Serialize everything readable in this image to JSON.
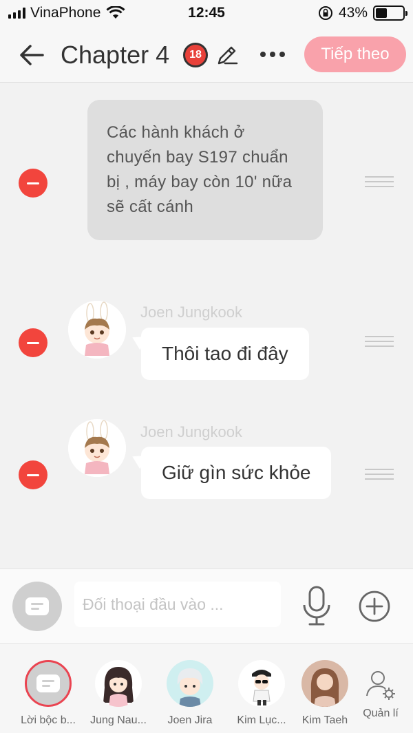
{
  "status_bar": {
    "carrier": "VinaPhone",
    "time": "12:45",
    "battery_percent": "43%",
    "battery_level": 0.43
  },
  "header": {
    "title": "Chapter 4",
    "rating_badge": "18",
    "next_button": "Tiếp theo"
  },
  "messages": [
    {
      "type": "narration",
      "text": "Các hành khách ở chuyến bay S197 chuẩn bị , máy bay còn 10' nữa sẽ cất cánh"
    },
    {
      "type": "dialog",
      "speaker": "Joen Jungkook",
      "text": "Thôi tao đi đây"
    },
    {
      "type": "dialog",
      "speaker": "Joen Jungkook",
      "text": "Giữ gìn sức khỏe"
    }
  ],
  "input": {
    "placeholder": "Đối thoại đầu vào ..."
  },
  "characters": [
    {
      "name": "Lời bộc b...",
      "selected": true,
      "icon": "narration-icon"
    },
    {
      "name": "Jung Nau...",
      "selected": false,
      "icon": "avatar-girl"
    },
    {
      "name": "Joen Jira",
      "selected": false,
      "icon": "avatar-boy-silver"
    },
    {
      "name": "Kim Lục...",
      "selected": false,
      "icon": "avatar-boy-sunglasses"
    },
    {
      "name": "Kim Taeh",
      "selected": false,
      "icon": "avatar-girl-photo"
    }
  ],
  "manage": {
    "label": "Quản lí",
    "icon": "user-settings-icon"
  },
  "colors": {
    "accent_pink": "#f9a2ab",
    "delete_red": "#f2453d",
    "selected_ring": "#ea4451"
  }
}
